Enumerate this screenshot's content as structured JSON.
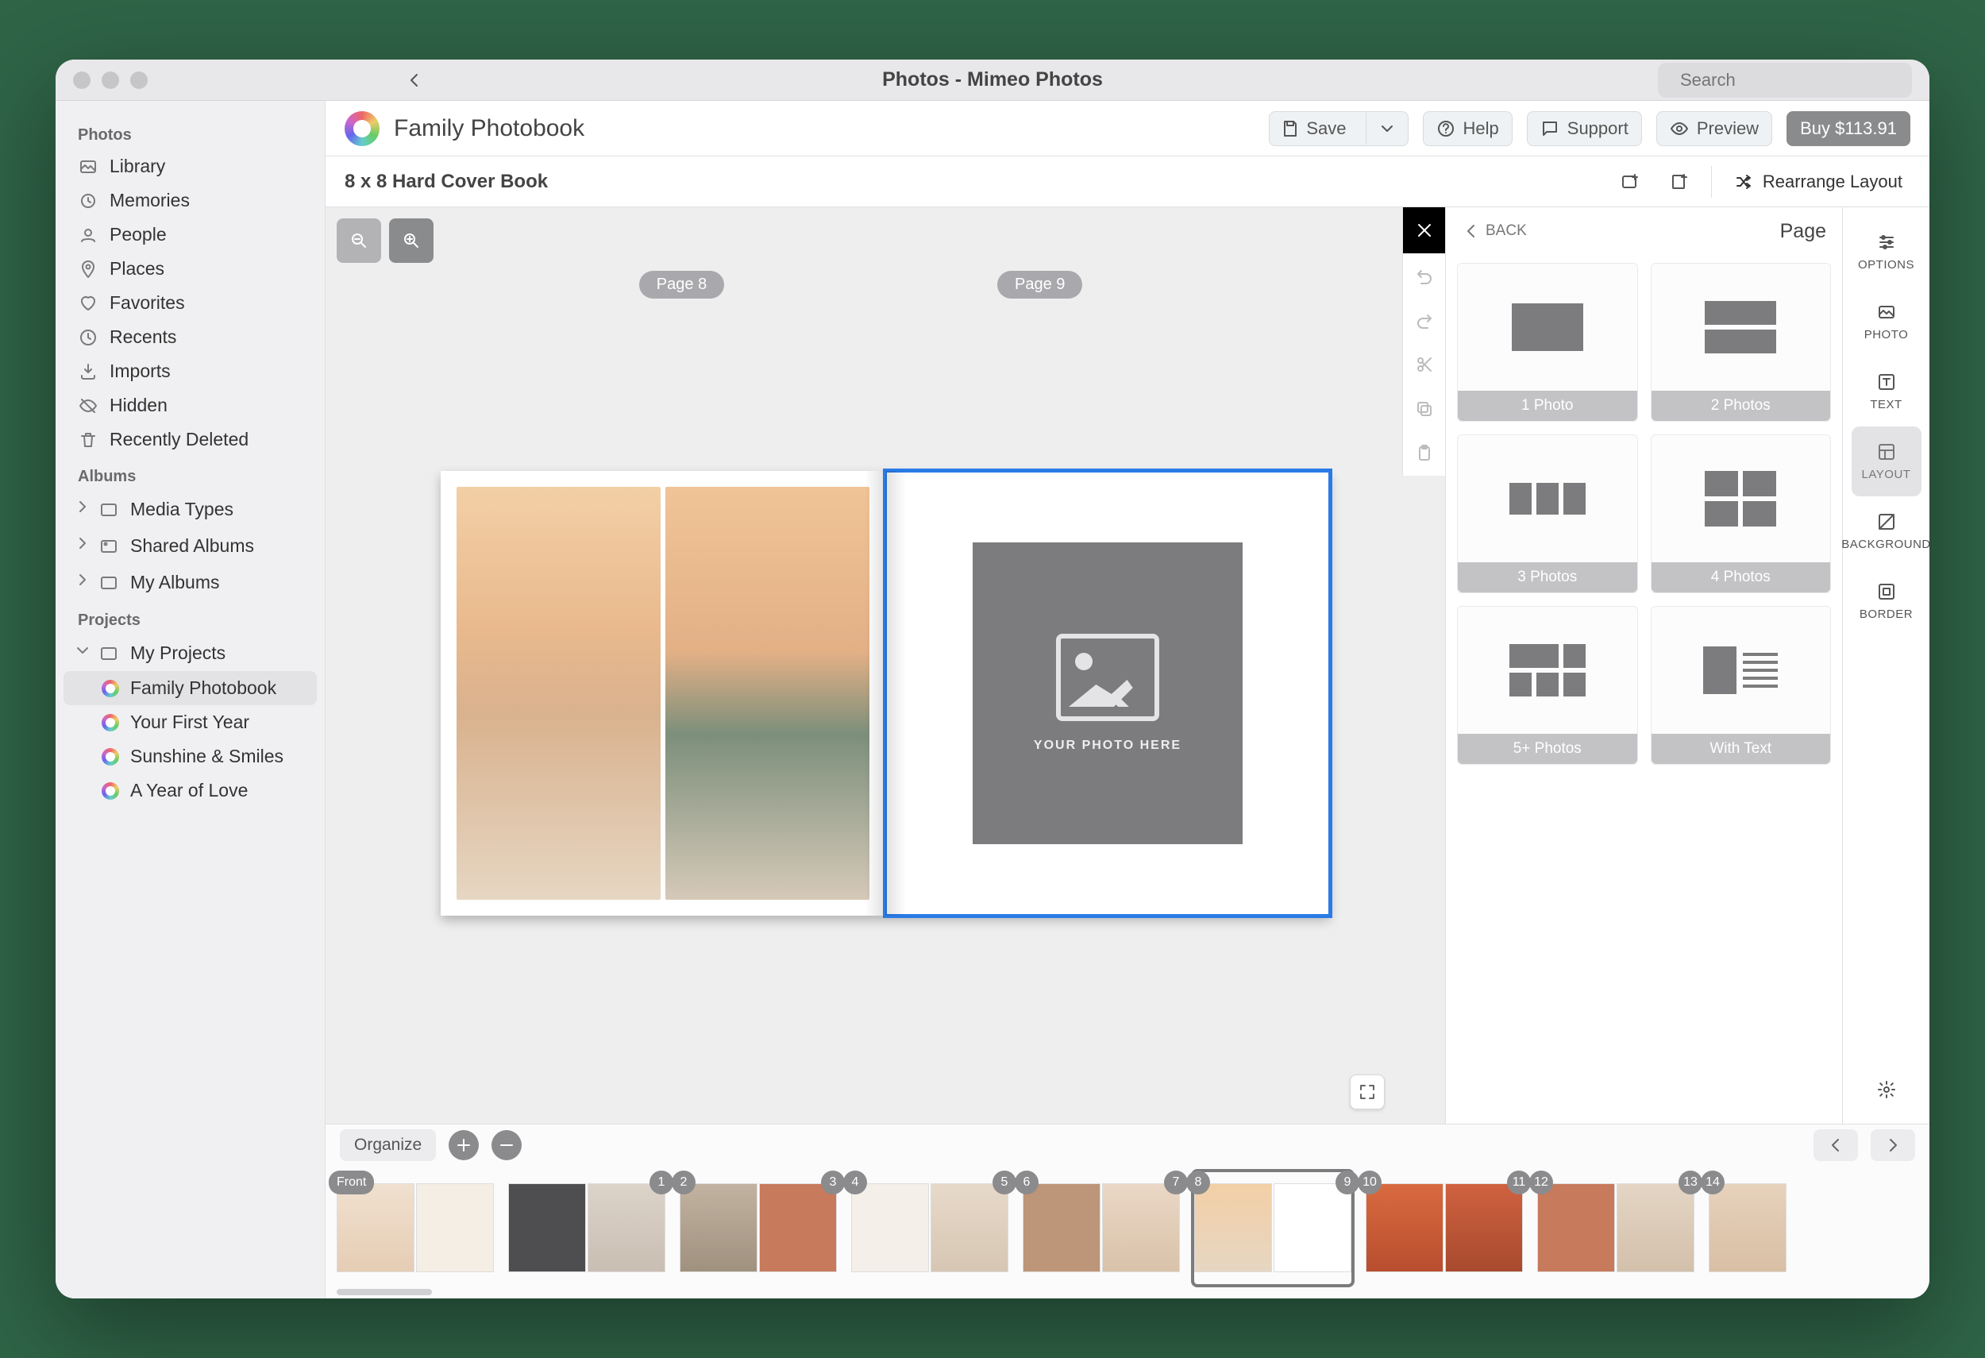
{
  "window": {
    "title": "Photos - Mimeo Photos",
    "search_placeholder": "Search"
  },
  "sidebar": {
    "sections": {
      "photos": {
        "header": "Photos",
        "items": [
          "Library",
          "Memories",
          "People",
          "Places",
          "Favorites",
          "Recents",
          "Imports",
          "Hidden",
          "Recently Deleted"
        ]
      },
      "albums": {
        "header": "Albums",
        "items": [
          "Media Types",
          "Shared Albums",
          "My Albums"
        ]
      },
      "projects": {
        "header": "Projects",
        "root": "My Projects",
        "items": [
          "Family Photobook",
          "Your First Year",
          "Sunshine & Smiles",
          "A Year of Love"
        ],
        "selected": "Family Photobook"
      }
    }
  },
  "projectbar": {
    "title": "Family Photobook",
    "save": "Save",
    "help": "Help",
    "support": "Support",
    "preview": "Preview",
    "buy": "Buy $113.91"
  },
  "toolbar": {
    "desc": "8 x 8 Hard Cover Book",
    "rearrange": "Rearrange Layout"
  },
  "spread": {
    "leftLabel": "Page 8",
    "rightLabel": "Page 9",
    "placeholder": "YOUR PHOTO HERE"
  },
  "layoutpanel": {
    "back": "BACK",
    "title": "Page",
    "options": [
      "1 Photo",
      "2 Photos",
      "3 Photos",
      "4 Photos",
      "5+ Photos",
      "With Text"
    ]
  },
  "rightstrip": {
    "items": [
      "OPTIONS",
      "PHOTO",
      "TEXT",
      "LAYOUT",
      "BACKGROUND",
      "BORDER"
    ],
    "selected": "LAYOUT"
  },
  "tray": {
    "organize": "Organize",
    "front": "Front",
    "badges": [
      "1",
      "2",
      "3",
      "4",
      "5",
      "6",
      "7",
      "8",
      "9",
      "10",
      "11",
      "12",
      "13",
      "14"
    ]
  }
}
